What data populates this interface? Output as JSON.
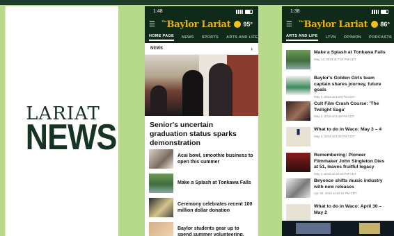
{
  "logo": {
    "line1": "LARIAT",
    "line2": "NEWS"
  },
  "phone1": {
    "time": "1:48",
    "masthead": "Baylor Lariat",
    "masthead_prefix": "The",
    "temperature": "95°",
    "tabs": [
      "HOME PAGE",
      "NEWS",
      "SPORTS",
      "ARTS AND LIFE"
    ],
    "section": "NEWS",
    "headline": "Senior's uncertain graduation status sparks demonstration",
    "items": [
      {
        "title": "Acai bowl, smoothie business to open this summer"
      },
      {
        "title": "Make a Splash at Tonkawa Falls"
      },
      {
        "title": "Ceremony celebrates recent 100 million dollar donation"
      },
      {
        "title": "Baylor students gear up to spend summer volunteering,"
      }
    ]
  },
  "phone2": {
    "time": "1:38",
    "masthead": "Baylor Lariat",
    "masthead_prefix": "The",
    "temperature": "86°",
    "tabs": [
      "ARTS AND LIFE",
      "LTVN",
      "OPINION",
      "PODCASTS"
    ],
    "items": [
      {
        "title": "Make a Splash at Tonkawa Falls",
        "date": "May 13, 2019 at 7:54 PM CDT"
      },
      {
        "title": "Baylor's Golden Girls team captain shares journey, future goals",
        "date": "May 2, 2019 at 9:19 PM CDT"
      },
      {
        "title": "Cult Film Crash Course: 'The Twilight Saga'",
        "date": "May 2, 2019 at 8:49 PM CDT"
      },
      {
        "title": "What to do in Waco: May 3 – 4",
        "date": "May 2, 2019 at 8:45 PM CDT"
      },
      {
        "title": "Remembering: Pioneer Filmmaker John Singleton Dies at 51, leaves fruitful legacy",
        "date": "May 1, 2019 at 10:34 PM CDT"
      },
      {
        "title": "Beyonce shifts music industry with new releases",
        "date": "Apr 30, 2019 at 10:34 PM CDT"
      },
      {
        "title": "What to do in Waco: April 30 – May 2",
        "date": ""
      }
    ]
  },
  "colors": {
    "dark_green": "#102a1a",
    "gold": "#e7b11b",
    "background": "#b6d98a"
  },
  "icons": [
    "menu-icon",
    "sun-icon",
    "chevron-right-icon",
    "signal-icon",
    "battery-icon"
  ]
}
